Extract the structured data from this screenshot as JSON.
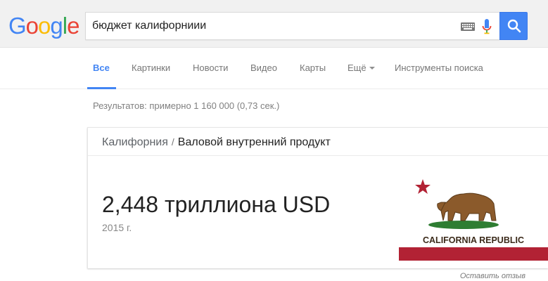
{
  "logo": {
    "text": "Google",
    "letters": [
      "G",
      "o",
      "o",
      "g",
      "l",
      "e"
    ],
    "colors": [
      "#4285f4",
      "#ea4335",
      "#fbbc05",
      "#4285f4",
      "#34a853",
      "#ea4335"
    ]
  },
  "search": {
    "query": "бюджет калифорниии",
    "keyboard_icon": "keyboard-icon",
    "mic_icon": "microphone-icon",
    "button_icon": "search-icon"
  },
  "tabs": [
    {
      "label": "Все",
      "active": true
    },
    {
      "label": "Картинки",
      "active": false
    },
    {
      "label": "Новости",
      "active": false
    },
    {
      "label": "Видео",
      "active": false
    },
    {
      "label": "Карты",
      "active": false
    },
    {
      "label": "Ещё",
      "active": false,
      "dropdown": true
    },
    {
      "label": "Инструменты поиска",
      "active": false
    }
  ],
  "result_stats": "Результатов: примерно 1 160 000 (0,73 сек.)",
  "knowledge_card": {
    "entity": "Калифорния",
    "separator": "/",
    "topic": "Валовой внутренний продукт",
    "value": "2,448 триллиона USD",
    "year": "2015 г.",
    "flag": {
      "text": "CALIFORNIA REPUBLIC",
      "star_color": "#b22234",
      "stripe_color": "#b22234",
      "bear_color": "#8b5a2b",
      "grass_color": "#2e7d32"
    }
  },
  "feedback_link": "Оставить отзыв",
  "colors": {
    "accent": "#4285f4",
    "header_bg": "#f1f1f1"
  }
}
